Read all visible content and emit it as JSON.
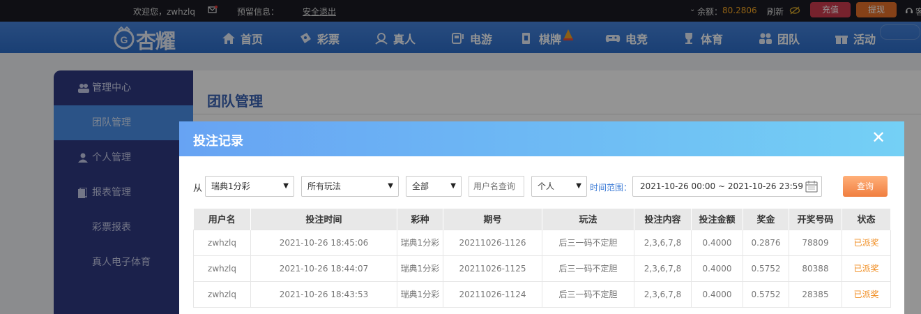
{
  "topbar": {
    "welcome": "欢迎您，zwhzlq",
    "reserve_label": "预留信息：",
    "logout": "安全退出",
    "balance_label": "余额：",
    "balance_value": "80.2806",
    "refresh": "刷新",
    "recharge": "充值",
    "withdraw": "提现"
  },
  "logo": {
    "text": "杏耀"
  },
  "nav": [
    "首页",
    "彩票",
    "真人",
    "电游",
    "棋牌",
    "电竞",
    "体育",
    "团队",
    "活动"
  ],
  "sidebar": {
    "items": [
      {
        "label": "管理中心"
      },
      {
        "label": "团队管理"
      },
      {
        "label": "个人管理"
      },
      {
        "label": "报表管理"
      },
      {
        "label": "彩票报表"
      },
      {
        "label": "真人电子体育"
      }
    ]
  },
  "page": {
    "title": "团队管理"
  },
  "modal": {
    "title": "投注记录",
    "close": "✕",
    "filters": {
      "from_label": "从",
      "lottery": "瑞典1分彩",
      "play": "所有玩法",
      "scope": "全部",
      "username_placeholder": "用户名查询",
      "person": "个人",
      "range_label": "时间范围：",
      "range_value": "2021-10-26 00:00 ~ 2021-10-26 23:59",
      "query": "查询"
    },
    "columns": [
      "用户名",
      "投注时间",
      "彩种",
      "期号",
      "玩法",
      "投注内容",
      "投注金额",
      "奖金",
      "开奖号码",
      "状态"
    ],
    "rows": [
      [
        "zwhzlq",
        "2021-10-26 18:45:06",
        "瑞典1分彩",
        "20211026-1126",
        "后三一码不定胆",
        "2,3,6,7,8",
        "0.4000",
        "0.2876",
        "78809",
        "已派奖"
      ],
      [
        "zwhzlq",
        "2021-10-26 18:44:07",
        "瑞典1分彩",
        "20211026-1125",
        "后三一码不定胆",
        "2,3,6,7,8",
        "0.4000",
        "0.5752",
        "80388",
        "已派奖"
      ],
      [
        "zwhzlq",
        "2021-10-26 18:43:53",
        "瑞典1分彩",
        "20211026-1124",
        "后三一码不定胆",
        "2,3,6,7,8",
        "0.4000",
        "0.5752",
        "28385",
        "已派奖"
      ]
    ]
  },
  "colors": {
    "topbar": "#1a1b24",
    "nav": "#3a7bd5",
    "sidebar": "#2f3a82",
    "accent": "#f08b1d",
    "recharge": "#cc3b4e",
    "withdraw": "#e5702a"
  }
}
